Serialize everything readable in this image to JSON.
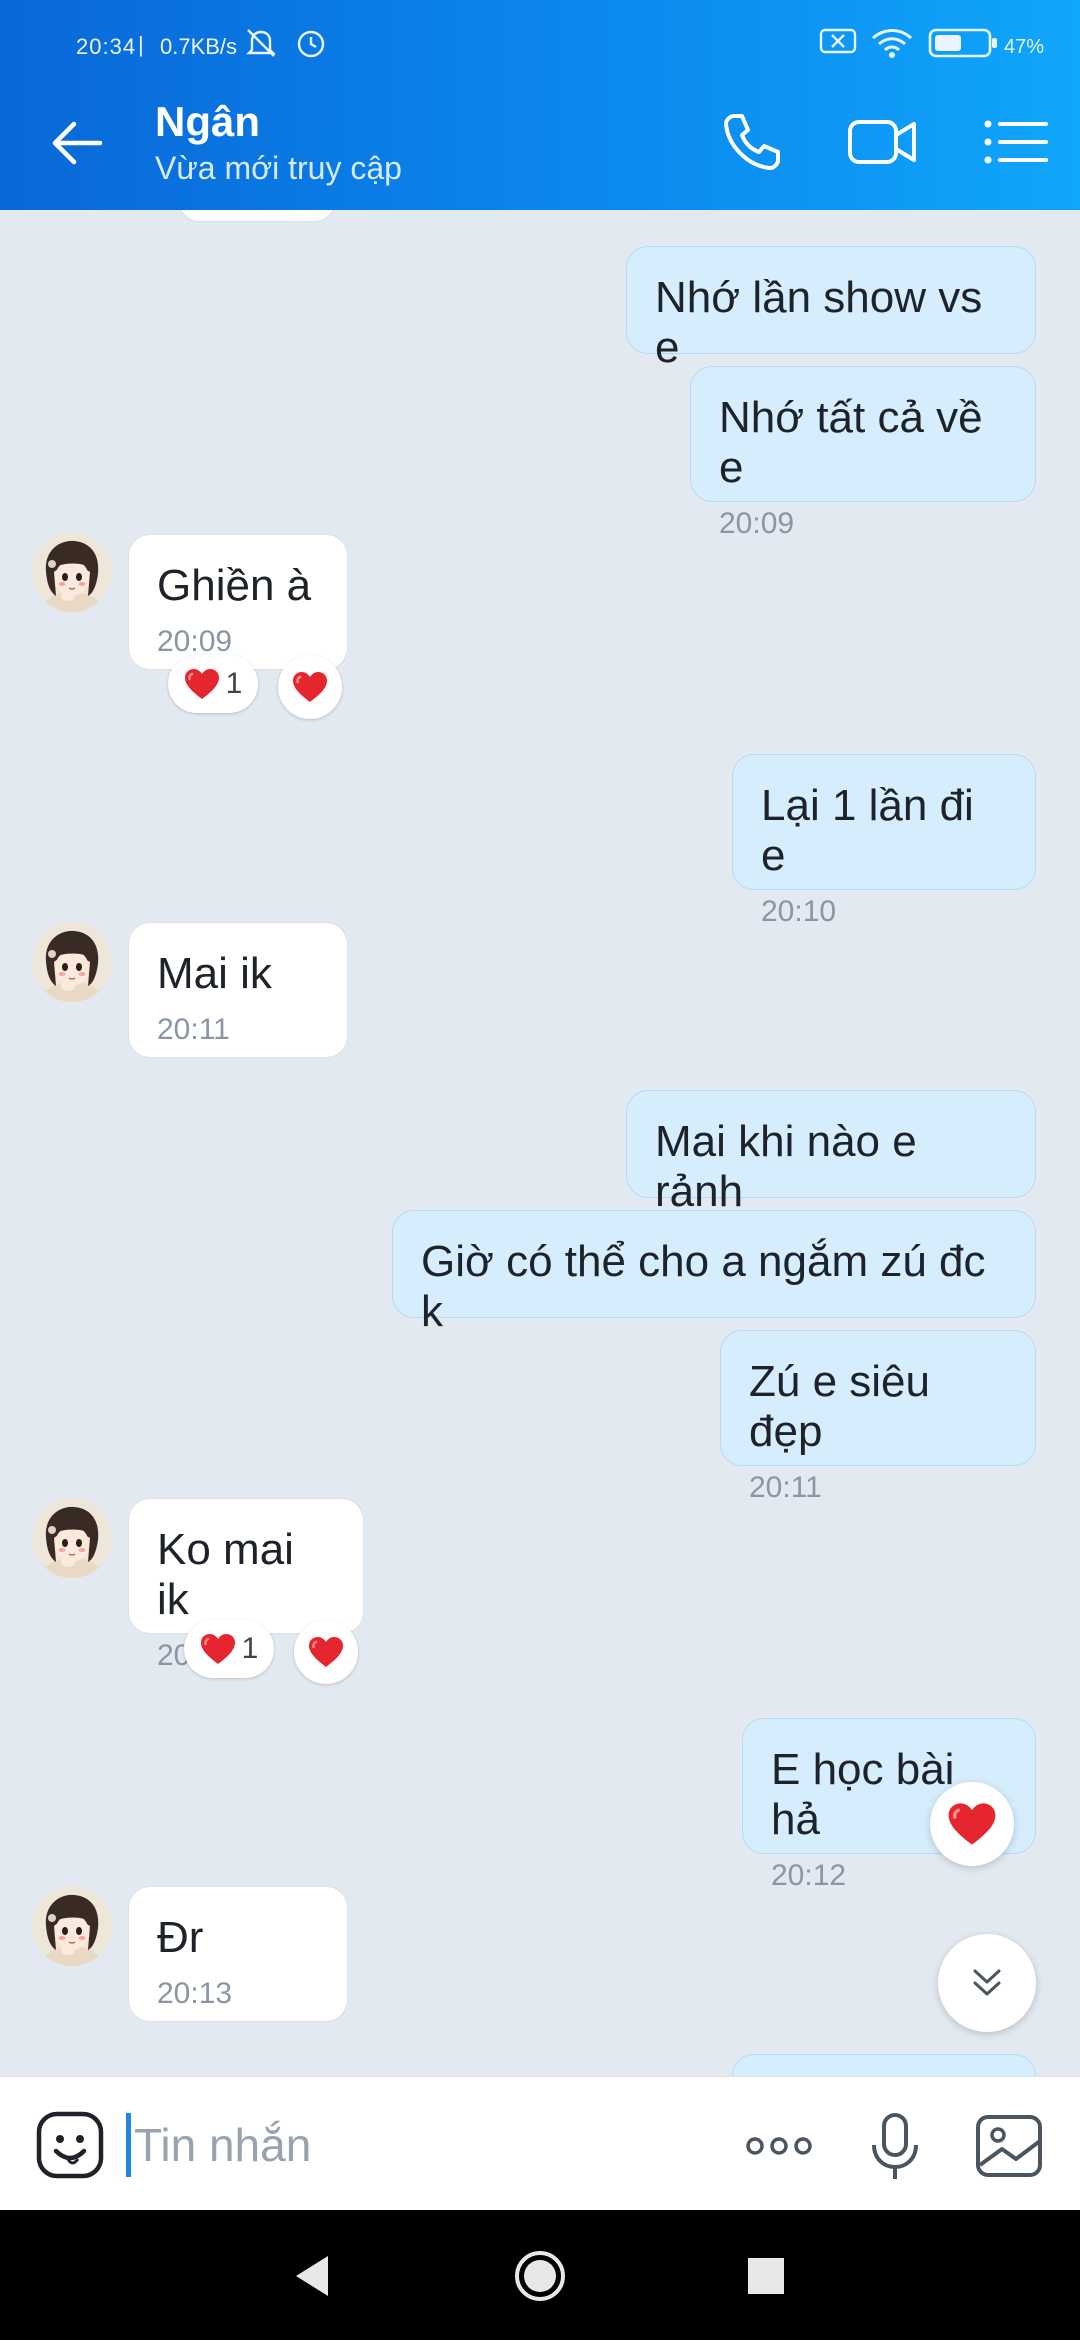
{
  "status_bar": {
    "time": "20:34",
    "speed": "0.7KB/s",
    "battery": "47%"
  },
  "header": {
    "name": "Ngân",
    "subtitle": "Vừa mới truy cập"
  },
  "messages": [
    {
      "text": "Nhớ lần show vs e",
      "time": ""
    },
    {
      "text": "Nhớ tất cả về e",
      "time": "20:09"
    },
    {
      "text": "Ghiền à",
      "time": "20:09",
      "reaction_count": "1"
    },
    {
      "text": "Lại 1 lần đi e",
      "time": "20:10"
    },
    {
      "text": "Mai ik",
      "time": "20:11"
    },
    {
      "text": "Mai khi nào e rảnh",
      "time": ""
    },
    {
      "text": "Giờ có thể cho a ngắm zú đc k",
      "time": ""
    },
    {
      "text": "Zú e siêu đẹp",
      "time": "20:11"
    },
    {
      "text": "Ko mai ik",
      "time": "20:12",
      "reaction_count": "1"
    },
    {
      "text": "E học bài hả",
      "time": "20:12"
    },
    {
      "text": "Đr",
      "time": "20:13"
    }
  ],
  "input": {
    "placeholder": "Tin nhắn"
  },
  "colors": {
    "header_blue": "#0b88ee",
    "outgoing_bubble": "#d5edfc",
    "incoming_bubble": "#ffffff",
    "chat_background": "#e2e9f1",
    "heart_red": "#e5262f"
  },
  "icons": {
    "header": [
      "back-arrow-icon",
      "phone-icon",
      "video-call-icon",
      "menu-list-icon"
    ],
    "input": [
      "sticker-icon",
      "more-options-icon",
      "microphone-icon",
      "image-icon"
    ],
    "nav": [
      "nav-back-icon",
      "nav-home-icon",
      "nav-recents-icon"
    ]
  }
}
